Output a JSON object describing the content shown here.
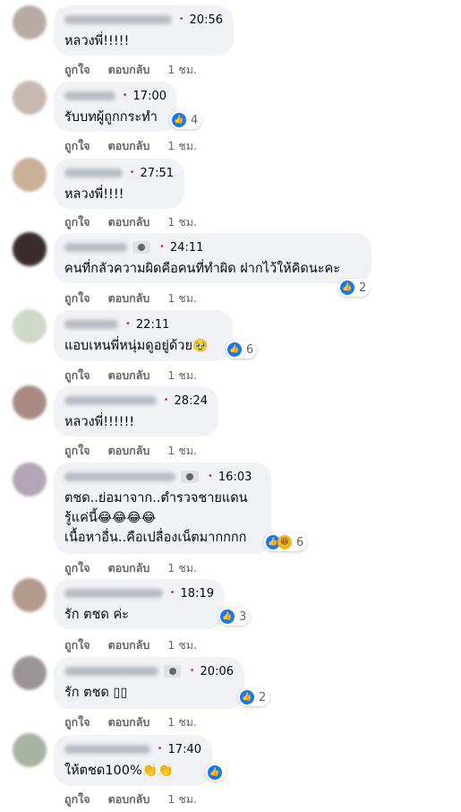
{
  "action_labels": {
    "like": "ถูกใจ",
    "reply": "ตอบกลับ",
    "age": "1 ชม."
  },
  "comments": [
    {
      "time": "20:56",
      "text": "หลวงพี่!!!!!",
      "reaction_count": ""
    },
    {
      "time": "17:00",
      "text": "รับบทผู้ถูกกระทำ",
      "reaction_count": "4"
    },
    {
      "time": "27:51",
      "text": "หลวงพี่!!!!",
      "reaction_count": ""
    },
    {
      "time": "24:11",
      "text": "คนที่กลัวความผิดคือคนที่ทำผิด ฝากไว้ให้คิดนะคะ",
      "reaction_count": "2"
    },
    {
      "time": "22:11",
      "text": "แอบเหนพี่หนุ่มดูอยู่ด้วย",
      "emoji": "🥹",
      "reaction_count": "6"
    },
    {
      "time": "28:24",
      "text": "หลวงพี่!!!!!!",
      "reaction_count": ""
    },
    {
      "time": "16:03",
      "line1": "ตชด..ย่อมาจาก..ตำรวจชายแดน",
      "line2": "รู้แค่นี้",
      "line2_emoji": "😂😂😂😂",
      "line3": "เนื้อหาอื่น..คือเปลื่องเน็ตมากกกก",
      "reaction_count": "6"
    },
    {
      "time": "18:19",
      "text": "รัก ตชด ค่ะ",
      "reaction_count": "3"
    },
    {
      "time": "20:06",
      "text": "รัก ตชด",
      "tail": "▯▯",
      "reaction_count": "2"
    },
    {
      "time": "17:40",
      "text": "ให้ตชด100%",
      "emoji": "👏👏",
      "reaction_count": ""
    }
  ],
  "icons": {
    "like": "thumbs-up-icon",
    "haha": "laughing-face-icon",
    "badge": "top-fan-badge-icon"
  },
  "colors": {
    "bubble": "#f0f2f5",
    "like_blue": "#1877f2",
    "meta_gray": "#65676b",
    "dot_red": "#e0245e"
  }
}
